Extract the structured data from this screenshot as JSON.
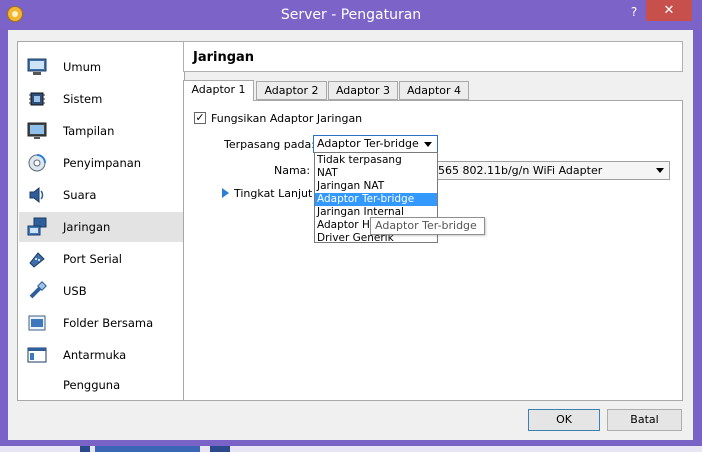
{
  "window": {
    "title": "Server - Pengaturan",
    "help_glyph": "?",
    "close_glyph": "✕"
  },
  "sidebar": {
    "items": [
      {
        "label": "Umum",
        "icon": "monitor-icon"
      },
      {
        "label": "Sistem",
        "icon": "chip-icon"
      },
      {
        "label": "Tampilan",
        "icon": "display-icon"
      },
      {
        "label": "Penyimpanan",
        "icon": "disk-icon"
      },
      {
        "label": "Suara",
        "icon": "speaker-icon"
      },
      {
        "label": "Jaringan",
        "icon": "network-icon",
        "selected": true
      },
      {
        "label": "Port Serial",
        "icon": "serial-port-icon"
      },
      {
        "label": "USB",
        "icon": "usb-icon"
      },
      {
        "label": "Folder Bersama",
        "icon": "folder-icon"
      },
      {
        "label": "Antarmuka Pengguna",
        "icon": "ui-window-icon"
      }
    ]
  },
  "page": {
    "title": "Jaringan"
  },
  "tabs": [
    {
      "label": "Adaptor 1",
      "active": true
    },
    {
      "label": "Adaptor 2"
    },
    {
      "label": "Adaptor 3"
    },
    {
      "label": "Adaptor 4"
    }
  ],
  "adapter": {
    "enable_label": "Fungsikan Adaptor Jaringan",
    "enabled_mark": "✓",
    "attached_label": "Terpasang pada:",
    "attached_value": "Adaptor Ter-bridge",
    "name_label": "Nama:",
    "name_value": "565 802.11b/g/n WiFi Adapter",
    "advanced_label": "Tingkat Lanjut"
  },
  "dropdown": {
    "options": [
      "Tidak terpasang",
      "NAT",
      "Jaringan NAT",
      "Adaptor Ter-bridge",
      "Jaringan Internal",
      "Adaptor Ha",
      "Driver Generik"
    ],
    "selected_index": 3
  },
  "tooltip": {
    "text": "Adaptor Ter-bridge"
  },
  "buttons": {
    "ok": "OK",
    "cancel": "Batal"
  },
  "colors": {
    "titlebar": "#7c63c8",
    "accent": "#3399ff",
    "close": "#c7504c"
  }
}
